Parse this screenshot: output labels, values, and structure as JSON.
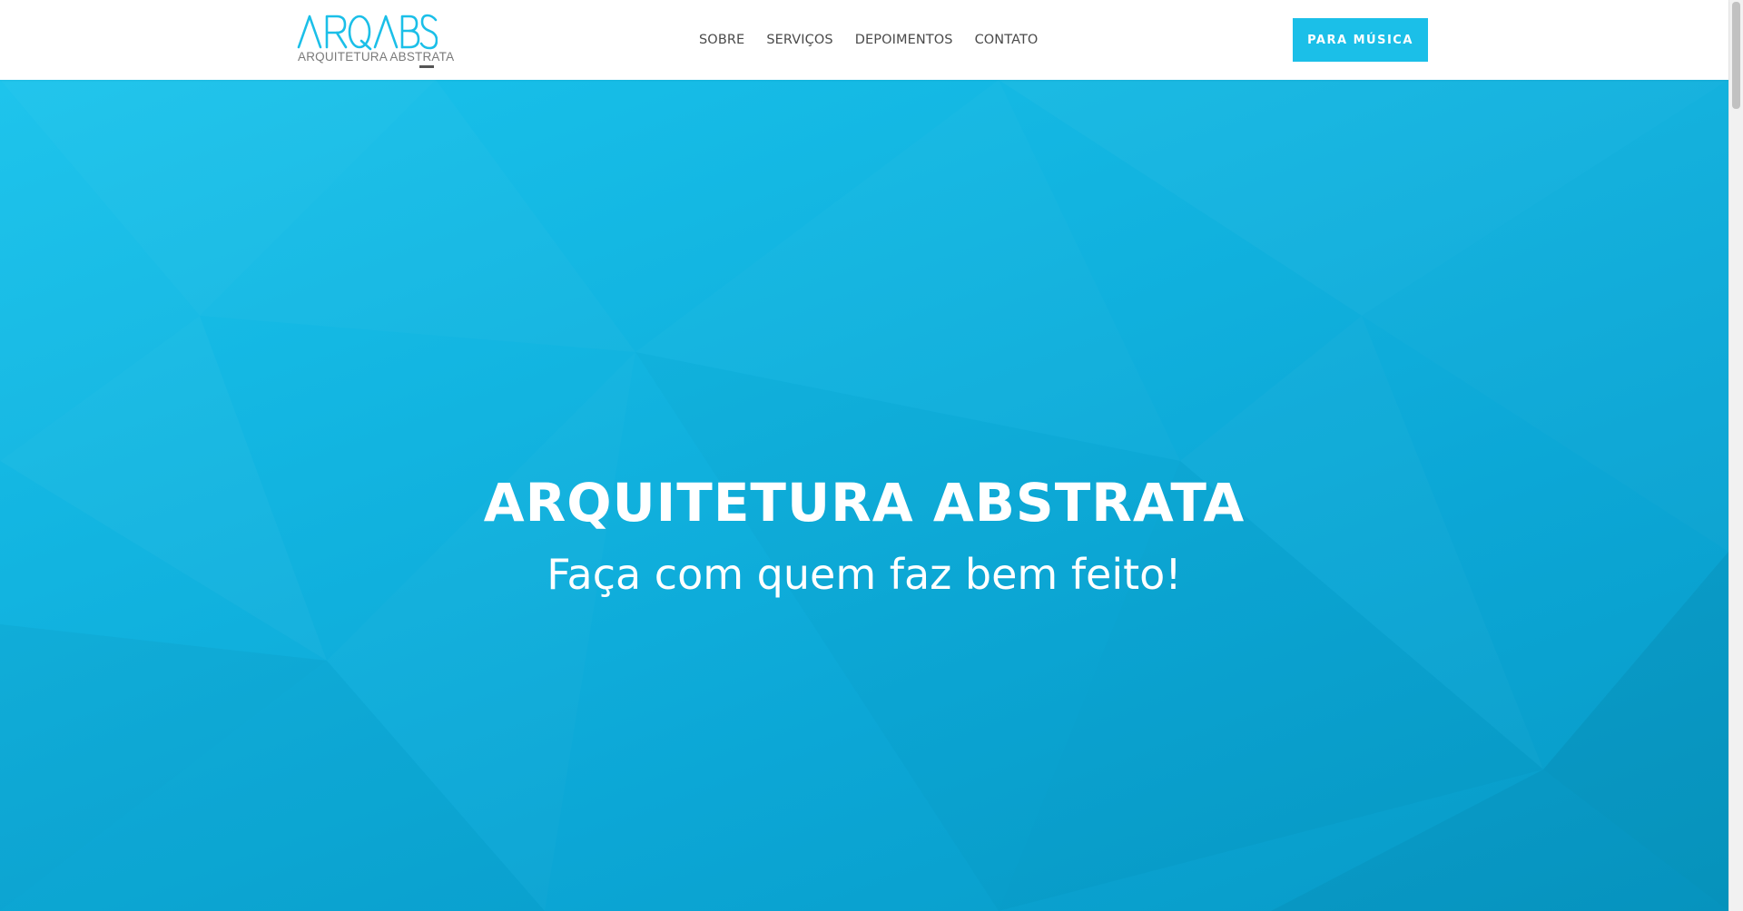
{
  "header": {
    "logo_text": "ARQABS",
    "logo_subtitle": "ARQUITETURA ABSTRATA",
    "nav": [
      {
        "label": "SOBRE"
      },
      {
        "label": "SERVIÇOS"
      },
      {
        "label": "DEPOIMENTOS"
      },
      {
        "label": "CONTATO"
      }
    ],
    "cta_label": "PARA MÚSICA"
  },
  "hero": {
    "title": "ARQUITETURA ABSTRATA",
    "subtitle": "Faça com quem faz bem feito!"
  },
  "colors": {
    "accent": "#1bbfe8",
    "hero_start": "#1ac3ec",
    "hero_end": "#079ac6",
    "nav_text": "#4a4a4a"
  }
}
